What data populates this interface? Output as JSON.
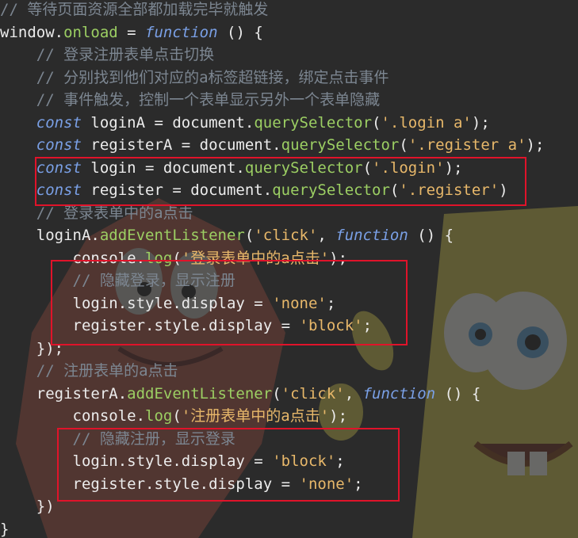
{
  "background": {
    "theme": "dark",
    "base_color": "#2b2b2b",
    "highlight_color": "#e0132a",
    "decorations": [
      "patrick-star-illustration",
      "spongebob-illustration"
    ]
  },
  "code": {
    "lines": [
      {
        "indent": "",
        "tokens": [
          {
            "t": "comment",
            "v": "// 等待页面资源全部都加载完毕就触发"
          }
        ]
      },
      {
        "indent": "",
        "tokens": [
          {
            "t": "plain",
            "v": "window."
          },
          {
            "t": "prop",
            "v": "onload"
          },
          {
            "t": "plain",
            "v": " = "
          },
          {
            "t": "kw",
            "v": "function"
          },
          {
            "t": "plain",
            "v": " () {"
          }
        ]
      },
      {
        "indent": "    ",
        "tokens": [
          {
            "t": "comment",
            "v": "// 登录注册表单点击切换"
          }
        ]
      },
      {
        "indent": "    ",
        "tokens": [
          {
            "t": "comment",
            "v": "// 分别找到他们对应的a标签超链接，绑定点击事件"
          }
        ]
      },
      {
        "indent": "    ",
        "tokens": [
          {
            "t": "comment",
            "v": "// 事件触发，控制一个表单显示另外一个表单隐藏"
          }
        ]
      },
      {
        "indent": "    ",
        "tokens": [
          {
            "t": "kw",
            "v": "const"
          },
          {
            "t": "plain",
            "v": " loginA = document."
          },
          {
            "t": "prop",
            "v": "querySelector"
          },
          {
            "t": "plain",
            "v": "("
          },
          {
            "t": "str",
            "v": "'.login a'"
          },
          {
            "t": "plain",
            "v": ");"
          }
        ]
      },
      {
        "indent": "    ",
        "tokens": [
          {
            "t": "kw",
            "v": "const"
          },
          {
            "t": "plain",
            "v": " registerA = document."
          },
          {
            "t": "prop",
            "v": "querySelector"
          },
          {
            "t": "plain",
            "v": "("
          },
          {
            "t": "str",
            "v": "'.register a'"
          },
          {
            "t": "plain",
            "v": ");"
          }
        ]
      },
      {
        "indent": "    ",
        "tokens": [
          {
            "t": "kw",
            "v": "const"
          },
          {
            "t": "plain",
            "v": " login = document."
          },
          {
            "t": "prop",
            "v": "querySelector"
          },
          {
            "t": "plain",
            "v": "("
          },
          {
            "t": "str",
            "v": "'.login'"
          },
          {
            "t": "plain",
            "v": ");"
          }
        ]
      },
      {
        "indent": "    ",
        "tokens": [
          {
            "t": "kw",
            "v": "const"
          },
          {
            "t": "plain",
            "v": " register = document."
          },
          {
            "t": "prop",
            "v": "querySelector"
          },
          {
            "t": "plain",
            "v": "("
          },
          {
            "t": "str",
            "v": "'.register'"
          },
          {
            "t": "plain",
            "v": ")"
          }
        ]
      },
      {
        "indent": "    ",
        "tokens": [
          {
            "t": "comment",
            "v": "// 登录表单中的a点击"
          }
        ]
      },
      {
        "indent": "    ",
        "tokens": [
          {
            "t": "plain",
            "v": "loginA."
          },
          {
            "t": "prop",
            "v": "addEventListener"
          },
          {
            "t": "plain",
            "v": "("
          },
          {
            "t": "str",
            "v": "'click'"
          },
          {
            "t": "plain",
            "v": ", "
          },
          {
            "t": "kw",
            "v": "function"
          },
          {
            "t": "plain",
            "v": " () {"
          }
        ]
      },
      {
        "indent": "        ",
        "tokens": [
          {
            "t": "plain",
            "v": "console."
          },
          {
            "t": "prop",
            "v": "log"
          },
          {
            "t": "plain",
            "v": "("
          },
          {
            "t": "str",
            "v": "'登录表单中的a点击'"
          },
          {
            "t": "plain",
            "v": ");"
          }
        ]
      },
      {
        "indent": "        ",
        "tokens": [
          {
            "t": "comment",
            "v": "// 隐藏登录，显示注册"
          }
        ]
      },
      {
        "indent": "        ",
        "tokens": [
          {
            "t": "plain",
            "v": "login.style.display = "
          },
          {
            "t": "str",
            "v": "'none'"
          },
          {
            "t": "plain",
            "v": ";"
          }
        ]
      },
      {
        "indent": "        ",
        "tokens": [
          {
            "t": "plain",
            "v": "register.style.display = "
          },
          {
            "t": "str",
            "v": "'block'"
          },
          {
            "t": "plain",
            "v": ";"
          }
        ]
      },
      {
        "indent": "    ",
        "tokens": [
          {
            "t": "plain",
            "v": "});"
          }
        ]
      },
      {
        "indent": "    ",
        "tokens": [
          {
            "t": "comment",
            "v": "// 注册表单的a点击"
          }
        ]
      },
      {
        "indent": "    ",
        "tokens": [
          {
            "t": "plain",
            "v": "registerA."
          },
          {
            "t": "prop",
            "v": "addEventListener"
          },
          {
            "t": "plain",
            "v": "("
          },
          {
            "t": "str",
            "v": "'click'"
          },
          {
            "t": "plain",
            "v": ", "
          },
          {
            "t": "kw",
            "v": "function"
          },
          {
            "t": "plain",
            "v": " () {"
          }
        ]
      },
      {
        "indent": "        ",
        "tokens": [
          {
            "t": "plain",
            "v": "console."
          },
          {
            "t": "prop",
            "v": "log"
          },
          {
            "t": "plain",
            "v": "("
          },
          {
            "t": "str",
            "v": "'注册表单中的a点击'"
          },
          {
            "t": "plain",
            "v": ");"
          }
        ]
      },
      {
        "indent": "        ",
        "tokens": [
          {
            "t": "comment",
            "v": "// 隐藏注册，显示登录"
          }
        ]
      },
      {
        "indent": "        ",
        "tokens": [
          {
            "t": "plain",
            "v": "login.style.display = "
          },
          {
            "t": "str",
            "v": "'block'"
          },
          {
            "t": "plain",
            "v": ";"
          }
        ]
      },
      {
        "indent": "        ",
        "tokens": [
          {
            "t": "plain",
            "v": "register.style.display = "
          },
          {
            "t": "str",
            "v": "'none'"
          },
          {
            "t": "plain",
            "v": ";"
          }
        ]
      },
      {
        "indent": "    ",
        "tokens": [
          {
            "t": "plain",
            "v": "})"
          }
        ]
      },
      {
        "indent": "",
        "tokens": [
          {
            "t": "plain",
            "v": "}"
          }
        ]
      }
    ]
  }
}
